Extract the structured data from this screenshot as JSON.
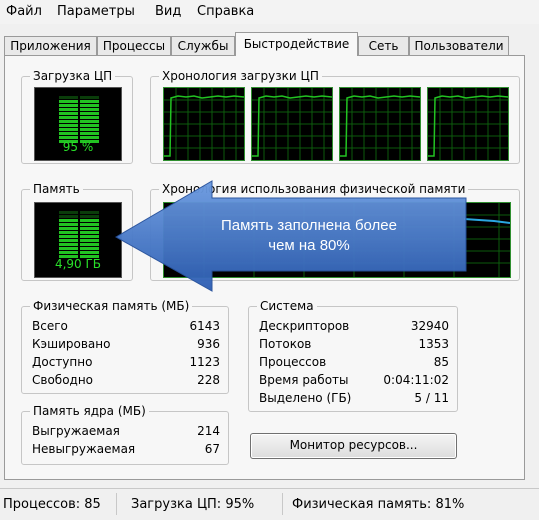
{
  "menu": [
    "Файл",
    "Параметры",
    "Вид",
    "Справка"
  ],
  "tabs": [
    "Приложения",
    "Процессы",
    "Службы",
    "Быстродействие",
    "Сеть",
    "Пользователи"
  ],
  "active_tab": "Быстродействие",
  "cpu": {
    "title": "Загрузка ЦП",
    "value": "95 %",
    "level": 0.95
  },
  "cpu_history": {
    "title": "Хронология загрузки ЦП"
  },
  "memory": {
    "title": "Память",
    "value": "4,90 ГБ",
    "level": 0.81
  },
  "memory_history": {
    "title": "Хронология использования физической памяти"
  },
  "physical_memory": {
    "title": "Физическая память (МБ)",
    "rows": [
      {
        "label": "Всего",
        "value": "6143"
      },
      {
        "label": "Кэшировано",
        "value": "936"
      },
      {
        "label": "Доступно",
        "value": "1123"
      },
      {
        "label": "Свободно",
        "value": "228"
      }
    ]
  },
  "kernel_memory": {
    "title": "Память ядра (МБ)",
    "rows": [
      {
        "label": "Выгружаемая",
        "value": "214"
      },
      {
        "label": "Невыгружаемая",
        "value": "67"
      }
    ]
  },
  "system": {
    "title": "Система",
    "rows": [
      {
        "label": "Дескрипторов",
        "value": "32940"
      },
      {
        "label": "Потоков",
        "value": "1353"
      },
      {
        "label": "Процессов",
        "value": "85"
      },
      {
        "label": "Время работы",
        "value": "0:04:11:02"
      },
      {
        "label": "Выделено (ГБ)",
        "value": "5 / 11"
      }
    ]
  },
  "resource_monitor_button": "Монитор ресурсов...",
  "status": {
    "processes": "Процессов: 85",
    "cpu": "Загрузка ЦП: 95%",
    "memory": "Физическая память: 81%"
  },
  "callout": {
    "line1": "Память заполнена более",
    "line2": "чем на 80%"
  },
  "colors": {
    "graph_green": "#22c322",
    "callout_blue": "#3a6fc4",
    "memory_line": "#2aa7e0"
  }
}
